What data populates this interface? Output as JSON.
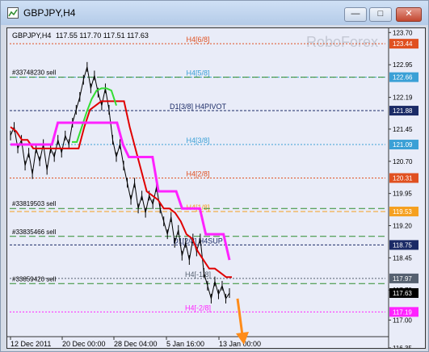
{
  "window": {
    "title": "GBPJPY,H4"
  },
  "header": {
    "symbol": "GBPJPY,H4",
    "ohlc": "117.55 117.70 117.51 117.63"
  },
  "watermark": "RoboForex",
  "colors": {
    "background": "#e9ecf8",
    "price_line": "#000000",
    "red_line": "#e00000",
    "green_line": "#33dd33",
    "magenta_line": "#ff22ff",
    "arrow": "#ff8c1a"
  },
  "chart_data": {
    "type": "line",
    "y_range": [
      116.35,
      123.8
    ],
    "y_ticks": [
      "123.70",
      "122.95",
      "122.19",
      "121.45",
      "120.70",
      "119.95",
      "119.20",
      "118.45",
      "117.70",
      "117.00",
      "116.35"
    ],
    "x_ticks": [
      "12 Dec 2011",
      "20 Dec 00:00",
      "28 Dec 04:00",
      "5 Jan 16:00",
      "13 Jan 00:00"
    ],
    "levels": [
      {
        "label": "H4[6/8]",
        "value": 123.44,
        "price_label": "123.44",
        "color": "#e05020"
      },
      {
        "label": "H4[5/8]",
        "value": 122.66,
        "price_label": "122.66",
        "color": "#3aa0d6"
      },
      {
        "label": "D1[3/8] H4PIVOT",
        "value": 121.88,
        "price_label": "121.88",
        "color": "#1a2a66"
      },
      {
        "label": "H4[3/8]",
        "value": 121.09,
        "price_label": "121.09",
        "color": "#3aa0d6"
      },
      {
        "label": "H4[2/8]",
        "value": 120.31,
        "price_label": "120.31",
        "color": "#e05020"
      },
      {
        "label": "H4[1/8]",
        "value": 119.53,
        "price_label": "119.53",
        "color": "#f5a020"
      },
      {
        "label": "D1[2/8] H4SUP",
        "value": 118.75,
        "price_label": "118.75",
        "color": "#1a2a66"
      },
      {
        "label": "H4[-1/8]",
        "value": 117.97,
        "price_label": "117.97",
        "color": "#556070"
      },
      {
        "label": "H4[-2/8]",
        "value": 117.19,
        "price_label": "117.19",
        "color": "#ff22ff"
      }
    ],
    "current_price": {
      "value": 117.63,
      "label": "117.63"
    },
    "orders": [
      {
        "label": "#33748230 sell",
        "value": 122.66
      },
      {
        "label": "#33819503 sell",
        "value": 119.6
      },
      {
        "label": "#33835466 sell",
        "value": 118.95
      },
      {
        "label": "#33859420 sell",
        "value": 117.85
      }
    ],
    "series": [
      {
        "values": [
          121.3,
          121.5,
          121.0,
          121.2,
          120.6,
          120.9,
          120.4,
          121.0,
          120.7,
          121.1,
          120.5,
          121.0,
          120.8,
          121.2,
          120.9,
          121.3,
          121.1,
          121.6,
          121.9,
          122.2,
          122.6,
          122.9,
          122.4,
          122.7,
          122.3,
          122.0,
          122.4,
          121.9,
          121.2,
          120.8,
          121.1,
          120.6,
          120.2,
          119.8,
          120.2,
          119.6,
          119.9,
          119.5,
          119.9,
          119.7,
          120.1,
          119.6,
          119.3,
          119.0,
          119.4,
          118.8,
          119.1,
          118.5,
          118.8,
          118.4,
          118.9,
          118.6,
          118.9,
          118.1,
          117.8,
          117.5,
          117.9,
          117.6,
          117.8,
          117.5,
          117.63
        ]
      },
      {
        "values": [
          121.5,
          121.4,
          121.2,
          121.2,
          121.0,
          121.0,
          121.0,
          121.0,
          121.0,
          121.0,
          121.0,
          121.0,
          121.0,
          121.5,
          121.9,
          122.0,
          122.1,
          122.1,
          122.1,
          122.1,
          122.1,
          121.5,
          121.0,
          120.5,
          120.0,
          119.9,
          119.8,
          119.6,
          119.6,
          119.5,
          119.3,
          119.0,
          118.9,
          118.6,
          118.4,
          118.2,
          118.2,
          118.1,
          118.0,
          118.0
        ]
      },
      {
        "values": [
          121.15,
          121.15,
          121.5,
          121.85,
          122.15,
          122.35,
          122.4,
          122.4,
          122.35,
          122.0
        ]
      },
      {
        "values": [
          121.09,
          121.09,
          121.09,
          121.09,
          121.09,
          121.09,
          121.09,
          121.09,
          121.6,
          121.6,
          121.6,
          121.6,
          121.6,
          121.6,
          121.6,
          121.6,
          121.6,
          121.6,
          121.6,
          121.09,
          120.8,
          120.8,
          120.8,
          120.8,
          120.8,
          120.0,
          120.0,
          120.0,
          120.0,
          119.6,
          119.6,
          119.6,
          119.6,
          119.0,
          119.0,
          119.0,
          119.0,
          118.4
        ]
      }
    ]
  }
}
